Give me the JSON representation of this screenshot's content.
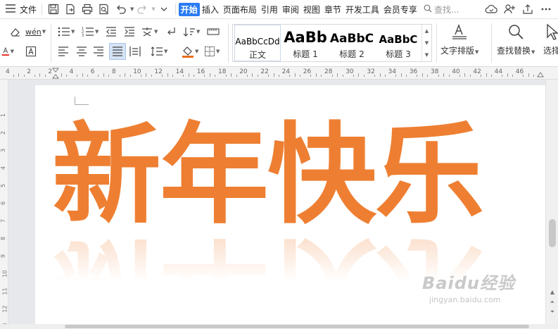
{
  "menubar": {
    "menu_label": "文件",
    "tabs": [
      "开始",
      "插入",
      "页面布局",
      "引用",
      "审阅",
      "视图",
      "章节",
      "开发工具",
      "会员专享"
    ],
    "active_tab": "开始",
    "search_placeholder": "查找..."
  },
  "ribbon": {
    "phonetic_label": "wén",
    "styles": [
      {
        "sample": "AaBbCcDd",
        "label": "正文"
      },
      {
        "sample": "AaBb",
        "label": "标题 1"
      },
      {
        "sample": "AaBbC",
        "label": "标题 2"
      },
      {
        "sample": "AaBbC",
        "label": "标题 3"
      }
    ],
    "text_layout_label": "文字排版",
    "find_replace_label": "查找替换",
    "select_label": "选择"
  },
  "ruler": {
    "numbers": [
      "4",
      "2",
      "2",
      "4",
      "6",
      "8",
      "10",
      "12",
      "14",
      "16",
      "18",
      "20",
      "22",
      "24",
      "26",
      "28",
      "30",
      "32",
      "34",
      "36",
      "38",
      "40",
      "42",
      "44",
      "46"
    ]
  },
  "vruler": {
    "numbers": [
      "1",
      "2",
      "3",
      "4",
      "5",
      "6",
      "7",
      "8",
      "9",
      "10",
      "11",
      "12",
      "13"
    ]
  },
  "document": {
    "headline": "新年快乐",
    "headline_color": "#ee7f32"
  },
  "watermark": {
    "brand": "Baidu经验",
    "url": "jingyan.baidu.com"
  },
  "colors": {
    "accent": "#2b7cf4",
    "font_color_bar": "#e83a30",
    "highlight_bar": "#e86e1a"
  }
}
